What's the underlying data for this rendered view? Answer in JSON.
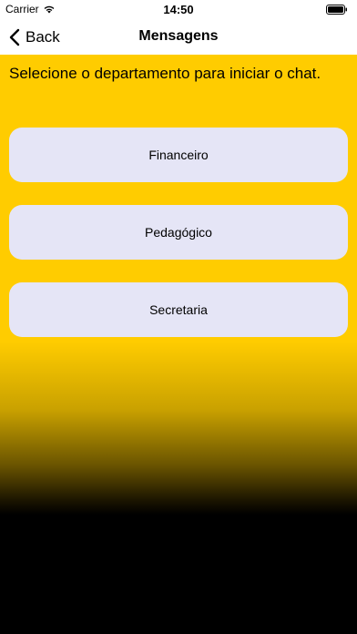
{
  "status_bar": {
    "carrier": "Carrier",
    "time": "14:50",
    "icons": [
      "wifi-icon",
      "battery-icon"
    ]
  },
  "nav": {
    "back_label": "Back",
    "back_icon": "chevron-left-icon",
    "title": "Mensagens"
  },
  "main": {
    "prompt": "Selecione o departamento para iniciar o chat.",
    "departments": [
      {
        "label": "Financeiro"
      },
      {
        "label": "Pedagógico"
      },
      {
        "label": "Secretaria"
      }
    ]
  },
  "colors": {
    "accent": "#ffcc00",
    "button_bg": "#e5e5f6",
    "bottom": "#000000"
  }
}
